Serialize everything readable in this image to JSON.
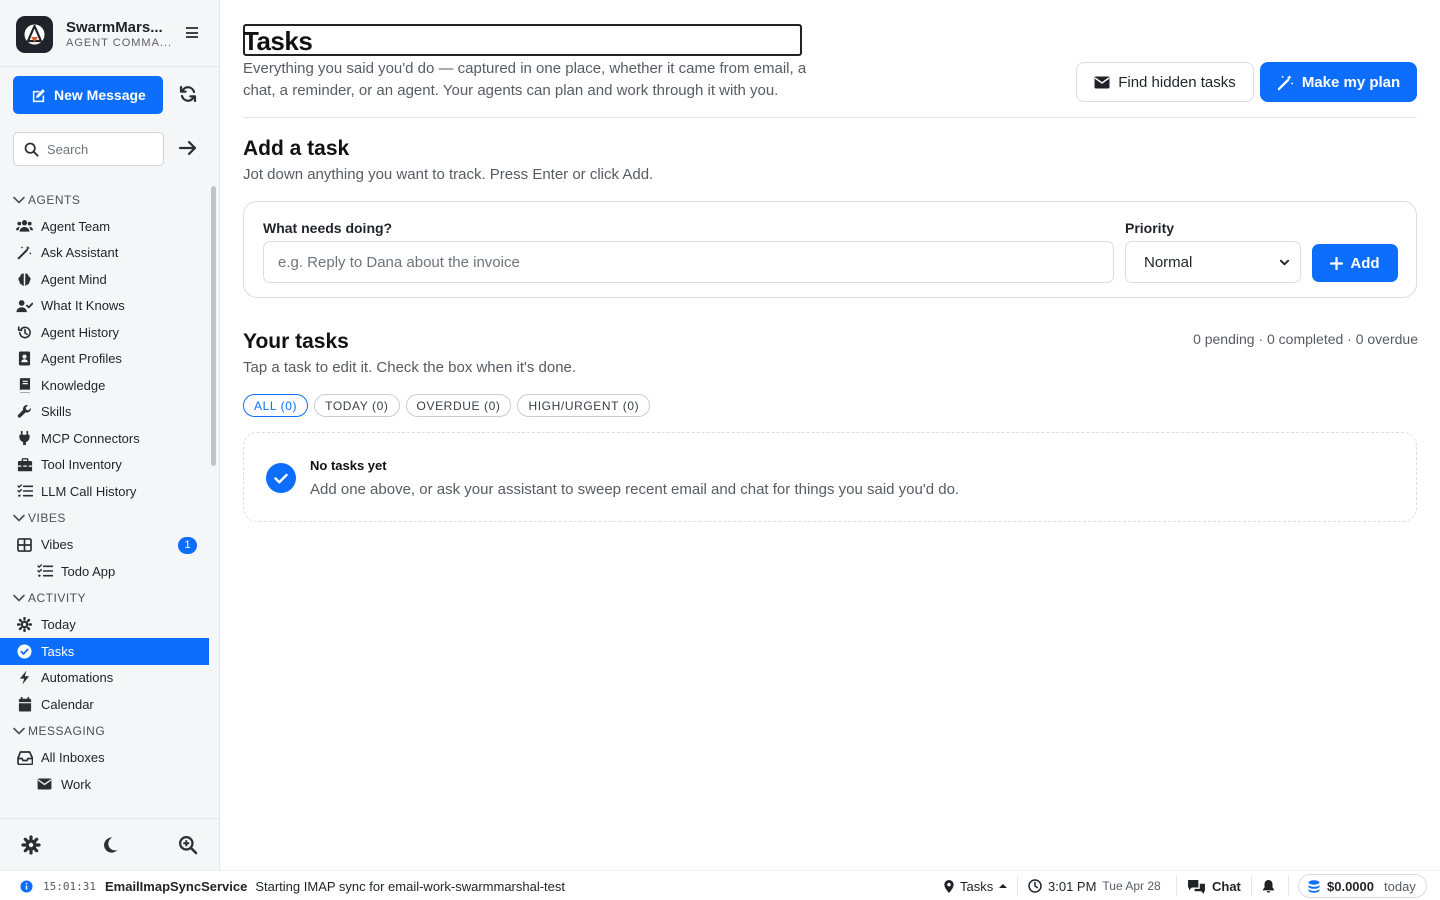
{
  "app": {
    "name": "SwarmMars...",
    "subtitle": "AGENT COMMA..."
  },
  "sidebar": {
    "new_message_label": "New Message",
    "search_placeholder": "Search",
    "sections": [
      {
        "title": "AGENTS",
        "items": [
          {
            "label": "Agent Team",
            "icon": "users-icon"
          },
          {
            "label": "Ask Assistant",
            "icon": "magic-wand-icon"
          },
          {
            "label": "Agent Mind",
            "icon": "brain-icon"
          },
          {
            "label": "What It Knows",
            "icon": "user-check-icon"
          },
          {
            "label": "Agent History",
            "icon": "history-icon"
          },
          {
            "label": "Agent Profiles",
            "icon": "id-card-icon"
          },
          {
            "label": "Knowledge",
            "icon": "book-icon"
          },
          {
            "label": "Skills",
            "icon": "wrench-icon"
          },
          {
            "label": "MCP Connectors",
            "icon": "plug-icon"
          },
          {
            "label": "Tool Inventory",
            "icon": "toolbox-icon"
          },
          {
            "label": "LLM Call History",
            "icon": "list-check-icon"
          }
        ]
      },
      {
        "title": "VIBES",
        "items": [
          {
            "label": "Vibes",
            "icon": "grid-icon",
            "badge": "1"
          },
          {
            "label": "Todo App",
            "icon": "list-check-icon",
            "sub": true
          }
        ]
      },
      {
        "title": "ACTIVITY",
        "items": [
          {
            "label": "Today",
            "icon": "sun-icon"
          },
          {
            "label": "Tasks",
            "icon": "check-circle-icon",
            "active": true
          },
          {
            "label": "Automations",
            "icon": "bolt-icon"
          },
          {
            "label": "Calendar",
            "icon": "calendar-icon"
          }
        ]
      },
      {
        "title": "MESSAGING",
        "items": [
          {
            "label": "All Inboxes",
            "icon": "inbox-icon"
          },
          {
            "label": "Work",
            "icon": "envelope-icon",
            "sub": true
          }
        ]
      }
    ]
  },
  "header": {
    "title": "Tasks",
    "subtitle": "Everything you said you'd do — captured in one place, whether it came from email, a chat, a reminder, or an agent. Your agents can plan and work through it with you.",
    "find_hidden_label": "Find hidden tasks",
    "make_plan_label": "Make my plan"
  },
  "add_task": {
    "heading": "Add a task",
    "description": "Jot down anything you want to track. Press Enter or click Add.",
    "input_label": "What needs doing?",
    "input_placeholder": "e.g. Reply to Dana about the invoice",
    "priority_label": "Priority",
    "priority_value": "Normal",
    "add_label": "Add"
  },
  "your_tasks": {
    "heading": "Your tasks",
    "description": "Tap a task to edit it. Check the box when it's done.",
    "counts": "0 pending · 0 completed · 0 overdue",
    "filters": [
      {
        "label": "ALL (0)",
        "active": true
      },
      {
        "label": "TODAY (0)",
        "active": false
      },
      {
        "label": "OVERDUE (0)",
        "active": false
      },
      {
        "label": "HIGH/URGENT (0)",
        "active": false
      }
    ],
    "empty_title": "No tasks yet",
    "empty_description": "Add one above, or ask your assistant to sweep recent email and chat for things you said you'd do."
  },
  "status_bar": {
    "log_time": "15:01:31",
    "log_service": "EmailImapSyncService",
    "log_message": "Starting IMAP sync for email-work-swarmmarshal-test",
    "location": "Tasks",
    "clock_time": "3:01 PM",
    "clock_date": "Tue Apr 28",
    "chat_label": "Chat",
    "cost_value": "$0.0000",
    "cost_period": "today"
  },
  "colors": {
    "accent": "#0d6efd",
    "sidebar_bg": "#f5f6f7",
    "text": "#1f2328",
    "muted": "#555c63"
  }
}
